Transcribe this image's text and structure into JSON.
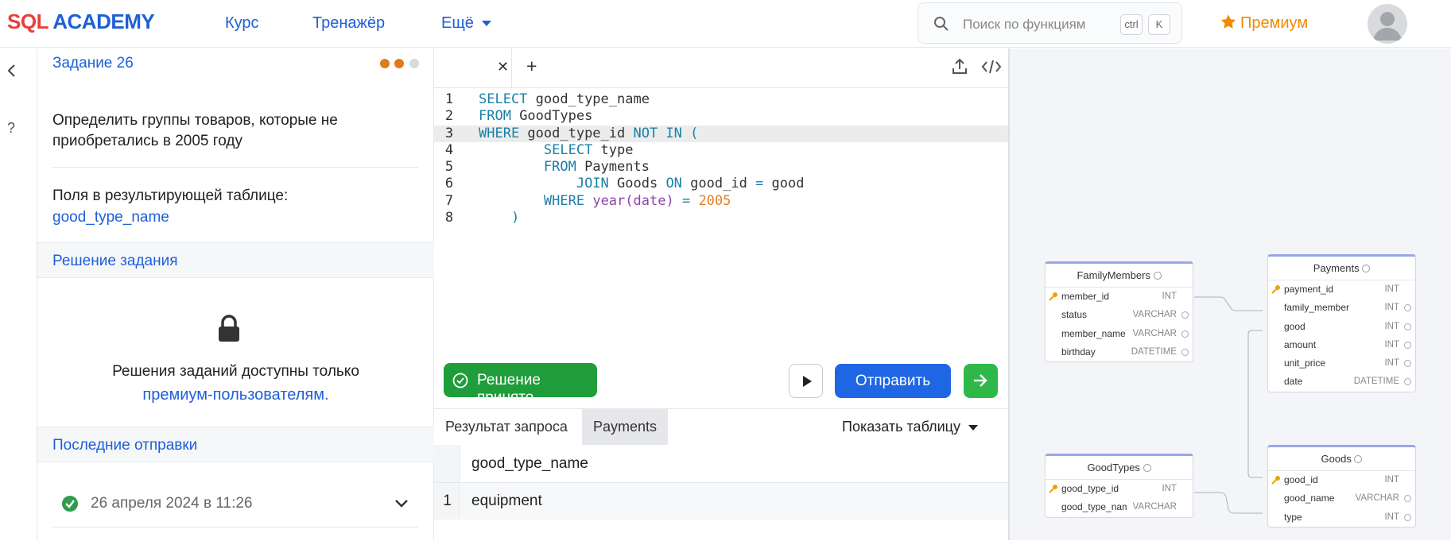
{
  "header": {
    "logo_sql": "SQL",
    "logo_academy": "ACADEMY",
    "nav_course": "Курс",
    "nav_trainer": "Тренажёр",
    "nav_more": "Ещё",
    "search_placeholder": "Поиск по функциям",
    "kbd_ctrl": "ctrl",
    "kbd_k": "K",
    "premium": "Премиум"
  },
  "task": {
    "title": "Задание 26",
    "description": "Определить группы товаров, которые не приобретались в 2005 году",
    "fields_label": "Поля в результирующей таблице:",
    "fields_value": "good_type_name",
    "solution_header": "Решение задания",
    "locked_line1": "Решения заданий доступны только",
    "locked_line2": "премиум-пользователям.",
    "submissions_header": "Последние отправки",
    "submission_date": "26 апреля 2024 в 11:26"
  },
  "editor": {
    "line_numbers": [
      "1",
      "2",
      "3",
      "4",
      "5",
      "6",
      "7",
      "8"
    ],
    "accepted_label": "Решение принято",
    "send_label": "Отправить"
  },
  "results": {
    "tab_result": "Результат запроса",
    "tab_payments": "Payments",
    "show_table": "Показать таблицу",
    "column": "good_type_name",
    "row_index": "1",
    "row_value": "equipment"
  },
  "diagram": {
    "family": {
      "name": "FamilyMembers",
      "fields": [
        [
          "member_id",
          "INT"
        ],
        [
          "status",
          "VARCHAR"
        ],
        [
          "member_name",
          "VARCHAR"
        ],
        [
          "birthday",
          "DATETIME"
        ]
      ]
    },
    "payments": {
      "name": "Payments",
      "fields": [
        [
          "payment_id",
          "INT"
        ],
        [
          "family_member",
          "INT"
        ],
        [
          "good",
          "INT"
        ],
        [
          "amount",
          "INT"
        ],
        [
          "unit_price",
          "INT"
        ],
        [
          "date",
          "DATETIME"
        ]
      ]
    },
    "goodtypes": {
      "name": "GoodTypes",
      "fields": [
        [
          "good_type_id",
          "INT"
        ],
        [
          "good_type_name",
          "VARCHAR"
        ]
      ]
    },
    "goods": {
      "name": "Goods",
      "fields": [
        [
          "good_id",
          "INT"
        ],
        [
          "good_name",
          "VARCHAR"
        ],
        [
          "type",
          "INT"
        ]
      ]
    }
  }
}
